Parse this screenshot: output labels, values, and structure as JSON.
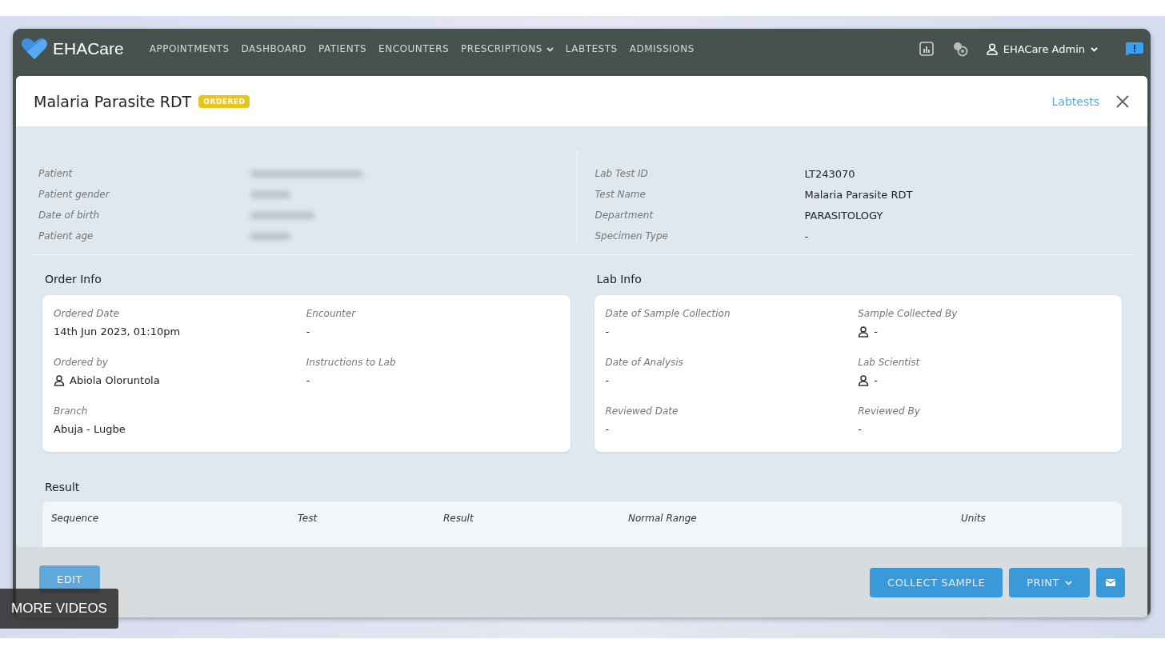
{
  "app": {
    "brand": "EHACare",
    "nav": [
      {
        "label": "APPOINTMENTS",
        "dropdown": false
      },
      {
        "label": "DASHBOARD",
        "dropdown": false
      },
      {
        "label": "PATIENTS",
        "dropdown": false
      },
      {
        "label": "ENCOUNTERS",
        "dropdown": false
      },
      {
        "label": "PRESCRIPTIONS",
        "dropdown": true
      },
      {
        "label": "LABTESTS",
        "dropdown": false
      },
      {
        "label": "ADMISSIONS",
        "dropdown": false
      }
    ],
    "user": "EHACare Admin"
  },
  "modal": {
    "title": "Malaria Parasite RDT",
    "status": "ORDERED",
    "link": "Labtests"
  },
  "patient_fields": [
    {
      "label": "Patient",
      "hidden": true
    },
    {
      "label": "Patient gender",
      "hidden": true
    },
    {
      "label": "Date of birth",
      "hidden": true
    },
    {
      "label": "Patient age",
      "hidden": true
    }
  ],
  "test_fields": [
    {
      "label": "Lab Test ID",
      "value": "LT243070"
    },
    {
      "label": "Test Name",
      "value": "Malaria Parasite RDT"
    },
    {
      "label": "Department",
      "value": "PARASITOLOGY"
    },
    {
      "label": "Specimen Type",
      "value": "-"
    }
  ],
  "sections": [
    {
      "title": "Order Info",
      "fields": [
        {
          "label": "Ordered Date",
          "value": "14th Jun 2023, 01:10pm",
          "person": false
        },
        {
          "label": "Encounter",
          "value": "-",
          "person": false
        },
        {
          "label": "Ordered by",
          "value": "Abiola Oloruntola",
          "person": true
        },
        {
          "label": "Instructions to Lab",
          "value": "-",
          "person": false
        },
        {
          "label": "Branch",
          "value": "Abuja - Lugbe",
          "person": false
        }
      ]
    },
    {
      "title": "Lab Info",
      "fields": [
        {
          "label": "Date of Sample Collection",
          "value": "-",
          "person": false
        },
        {
          "label": "Sample Collected By",
          "value": "-",
          "person": true
        },
        {
          "label": "Date of Analysis",
          "value": "-",
          "person": false
        },
        {
          "label": "Lab Scientist",
          "value": "-",
          "person": true
        },
        {
          "label": "Reviewed Date",
          "value": "-",
          "person": false
        },
        {
          "label": "Reviewed By",
          "value": "-",
          "person": false
        }
      ]
    }
  ],
  "result": {
    "title": "Result",
    "columns": [
      "Sequence",
      "Test",
      "Result",
      "Normal Range",
      "Units"
    ]
  },
  "left_actions": [
    {
      "kind": "text",
      "label": "EDIT"
    }
  ],
  "right_actions": [
    {
      "kind": "text",
      "label": "COLLECT SAMPLE"
    },
    {
      "kind": "dropdown",
      "label": "PRINT"
    },
    {
      "kind": "mail"
    }
  ],
  "overlay": {
    "label": "MORE VIDEOS"
  }
}
